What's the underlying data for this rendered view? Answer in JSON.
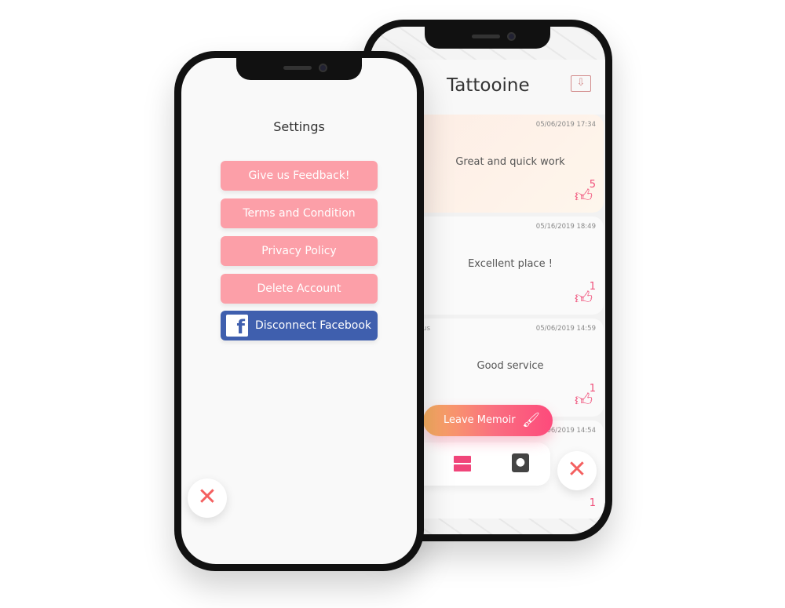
{
  "memoirs_screen": {
    "title": "Tattooine",
    "export_icon": "folder-download-icon",
    "cards": [
      {
        "user": "",
        "date": "05/06/2019 17:34",
        "text": "Great and quick work",
        "likes": "5"
      },
      {
        "user": "",
        "date": "05/16/2019 18:49",
        "text": "Excellent place !",
        "likes": "1"
      },
      {
        "user": "ous",
        "date": "05/06/2019 14:59",
        "text": "Good service",
        "likes": "1"
      },
      {
        "user": "",
        "date": "06/2019 14:54",
        "text": "",
        "likes": "1"
      }
    ],
    "leave_memoir_label": "Leave Memoir",
    "colors": {
      "accent": "#f0457a",
      "gradient_start": "#f7b060"
    }
  },
  "settings_screen": {
    "title": "Settings",
    "buttons": [
      "Give us Feedback!",
      "Terms and Condition",
      "Privacy Policy",
      "Delete Account"
    ],
    "facebook_label": "Disconnect Facebook",
    "colors": {
      "button": "#fc9fa8",
      "facebook": "#3f5fae",
      "close": "#f46060"
    }
  }
}
